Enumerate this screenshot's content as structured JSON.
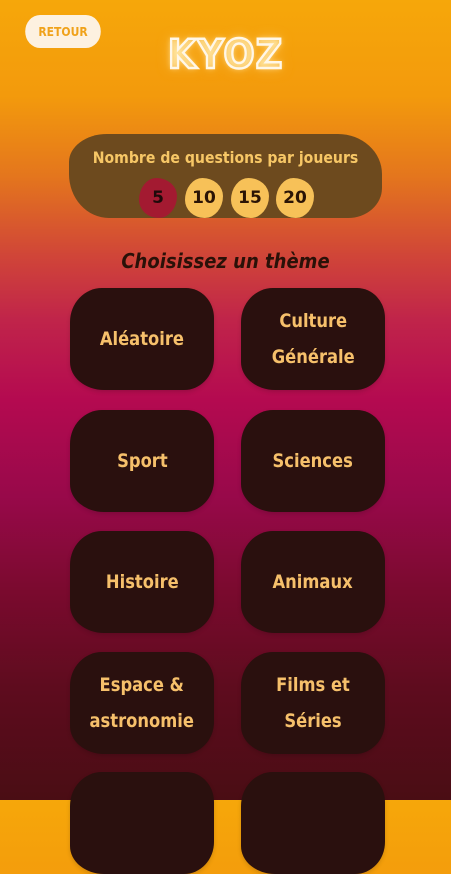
{
  "header": {
    "back_label": "RETOUR",
    "logo_text": "KYOZ"
  },
  "questions": {
    "title": "Nombre de questions par joueurs",
    "options": [
      "5",
      "10",
      "15",
      "20"
    ],
    "selected": "5"
  },
  "themes": {
    "heading": "Choisissez un thème",
    "items": [
      "Aléatoire",
      "Culture\nGénérale",
      "Sport",
      "Sciences",
      "Histoire",
      "Animaux",
      "Espace &\nastronomie",
      "Films et Séries",
      "",
      ""
    ]
  },
  "colors": {
    "accent": "#f7c158",
    "selected": "#a31a31",
    "card": "#2a100e",
    "card_text": "#f6c06b"
  }
}
